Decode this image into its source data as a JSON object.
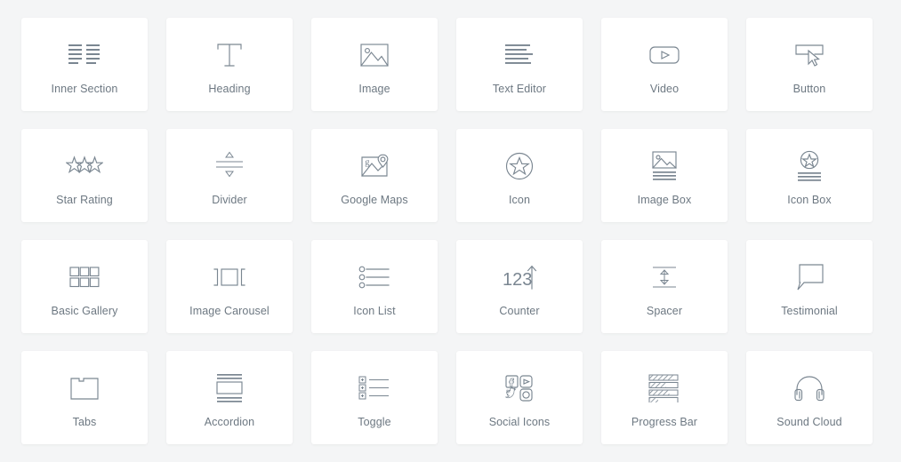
{
  "panel": {
    "background_color": "#f4f5f6",
    "card_background_color": "#ffffff",
    "icon_color": "#7a8691",
    "label_color": "#6d7882"
  },
  "widgets": [
    {
      "id": "inner-section",
      "label": "Inner Section",
      "icon": "inner-section-icon",
      "row": 1,
      "col": 1
    },
    {
      "id": "heading",
      "label": "Heading",
      "icon": "heading-icon",
      "row": 1,
      "col": 2
    },
    {
      "id": "image",
      "label": "Image",
      "icon": "image-icon",
      "row": 1,
      "col": 3
    },
    {
      "id": "text-editor",
      "label": "Text Editor",
      "icon": "text-editor-icon",
      "row": 1,
      "col": 4
    },
    {
      "id": "video",
      "label": "Video",
      "icon": "video-icon",
      "row": 1,
      "col": 5
    },
    {
      "id": "button",
      "label": "Button",
      "icon": "button-icon",
      "row": 1,
      "col": 6
    },
    {
      "id": "star-rating",
      "label": "Star Rating",
      "icon": "star-rating-icon",
      "row": 2,
      "col": 1
    },
    {
      "id": "divider",
      "label": "Divider",
      "icon": "divider-icon",
      "row": 2,
      "col": 2
    },
    {
      "id": "google-maps",
      "label": "Google Maps",
      "icon": "google-maps-icon",
      "row": 2,
      "col": 3
    },
    {
      "id": "icon",
      "label": "Icon",
      "icon": "icon-star-circle-icon",
      "row": 2,
      "col": 4
    },
    {
      "id": "image-box",
      "label": "Image Box",
      "icon": "image-box-icon",
      "row": 2,
      "col": 5
    },
    {
      "id": "icon-box",
      "label": "Icon Box",
      "icon": "icon-box-icon",
      "row": 2,
      "col": 6
    },
    {
      "id": "basic-gallery",
      "label": "Basic Gallery",
      "icon": "basic-gallery-icon",
      "row": 3,
      "col": 1
    },
    {
      "id": "image-carousel",
      "label": "Image Carousel",
      "icon": "image-carousel-icon",
      "row": 3,
      "col": 2
    },
    {
      "id": "icon-list",
      "label": "Icon List",
      "icon": "icon-list-icon",
      "row": 3,
      "col": 3
    },
    {
      "id": "counter",
      "label": "Counter",
      "icon": "counter-icon",
      "row": 3,
      "col": 4
    },
    {
      "id": "spacer",
      "label": "Spacer",
      "icon": "spacer-icon",
      "row": 3,
      "col": 5
    },
    {
      "id": "testimonial",
      "label": "Testimonial",
      "icon": "testimonial-icon",
      "row": 3,
      "col": 6
    },
    {
      "id": "tabs",
      "label": "Tabs",
      "icon": "tabs-icon",
      "row": 4,
      "col": 1
    },
    {
      "id": "accordion",
      "label": "Accordion",
      "icon": "accordion-icon",
      "row": 4,
      "col": 2
    },
    {
      "id": "toggle",
      "label": "Toggle",
      "icon": "toggle-icon",
      "row": 4,
      "col": 3
    },
    {
      "id": "social-icons",
      "label": "Social Icons",
      "icon": "social-icons-icon",
      "row": 4,
      "col": 4
    },
    {
      "id": "progress-bar",
      "label": "Progress Bar",
      "icon": "progress-bar-icon",
      "row": 4,
      "col": 5
    },
    {
      "id": "sound-cloud",
      "label": "Sound Cloud",
      "icon": "sound-cloud-icon",
      "row": 4,
      "col": 6
    }
  ],
  "counter_icon_text": "123",
  "google_maps_icon_letter": "g",
  "heading_icon_letter": "T",
  "toggle_icon_symbol": "+",
  "social_icon_letters": {
    "facebook": "f",
    "instagram": "o"
  },
  "progress_bar_fill_percents": [
    85,
    58,
    70,
    30
  ]
}
